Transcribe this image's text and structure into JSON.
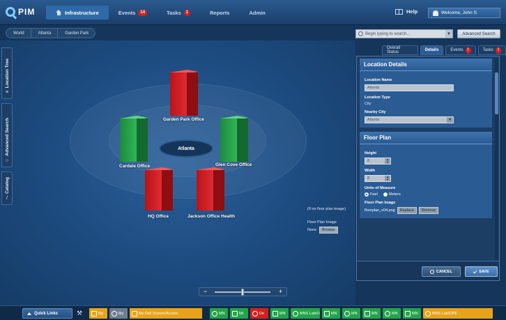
{
  "app": {
    "logo": "PIM"
  },
  "nav": {
    "items": [
      {
        "label": "Infrastructure",
        "active": true
      },
      {
        "label": "Events",
        "badge": "14"
      },
      {
        "label": "Tasks",
        "badge": "1"
      },
      {
        "label": "Reports"
      },
      {
        "label": "Admin"
      }
    ],
    "help": "Help",
    "welcome": "Welcome, John S."
  },
  "breadcrumb": [
    "World",
    "Atlanta",
    "Garden Park"
  ],
  "search": {
    "placeholder": "Begin typing to search...",
    "advanced": "Advanced Search"
  },
  "side_tabs": [
    "Location Tree",
    "Advanced Search",
    "Catalog"
  ],
  "map": {
    "hub": "Atlanta",
    "buildings": [
      {
        "label": "Garden Park Office",
        "status": "red"
      },
      {
        "label": "Cardale Office",
        "status": "green"
      },
      {
        "label": "Glen Cove Office",
        "status": "green"
      },
      {
        "label": "HQ Office",
        "status": "red"
      },
      {
        "label": "Jackson Office Health",
        "status": "red"
      }
    ],
    "floorplan_hint": "(If no floor plan image)",
    "floorplan_label": "Floor Plan Image",
    "floorplan_value": "None",
    "browse": "Browse",
    "zoom_level": 0.5
  },
  "tabs": [
    {
      "label": "Overall Status"
    },
    {
      "label": "Details",
      "active": true
    },
    {
      "label": "Events",
      "badge": "!"
    },
    {
      "label": "Tasks",
      "badge": "!"
    }
  ],
  "location_details": {
    "title": "Location Details",
    "name_label": "Location Name",
    "name_value": "Atlanta",
    "type_label": "Location Type",
    "type_value": "City",
    "nearby_label": "Nearby City",
    "nearby_value": "Atlanta"
  },
  "floor_plan": {
    "title": "Floor Plan",
    "height_label": "Height",
    "height_value": "8",
    "width_label": "Width",
    "width_value": "8",
    "units_label": "Units of Measure",
    "unit_feet": "Feet",
    "unit_meters": "Meters",
    "image_label": "Floor Plan Image",
    "image_file": "floorplan_v04.png",
    "replace": "Replace",
    "remove": "Remove"
  },
  "actions": {
    "cancel": "CANCEL",
    "save": "SAVE"
  },
  "taskbar": {
    "quick_links": "Quick Links",
    "items": [
      {
        "label": "My",
        "color": "#e8a31a"
      },
      {
        "label": "My",
        "color": "#6f7d8c"
      },
      {
        "label": "My Dell Screen/Access",
        "color": "#e8a31a"
      },
      {
        "label": "MN",
        "color": "#24a44a"
      },
      {
        "label": "Mt",
        "color": "#24a44a"
      },
      {
        "label": "De",
        "color": "#d42020"
      },
      {
        "label": "MN",
        "color": "#24a44a"
      },
      {
        "label": "MNS Lab/O",
        "color": "#24a44a"
      },
      {
        "label": "MN",
        "color": "#24a44a"
      },
      {
        "label": "MN",
        "color": "#24a44a"
      },
      {
        "label": "MN",
        "color": "#24a44a"
      },
      {
        "label": "MN",
        "color": "#24a44a"
      },
      {
        "label": "MN",
        "color": "#24a44a"
      },
      {
        "label": "MNS Lab/OPE",
        "color": "#e8a31a"
      }
    ]
  }
}
